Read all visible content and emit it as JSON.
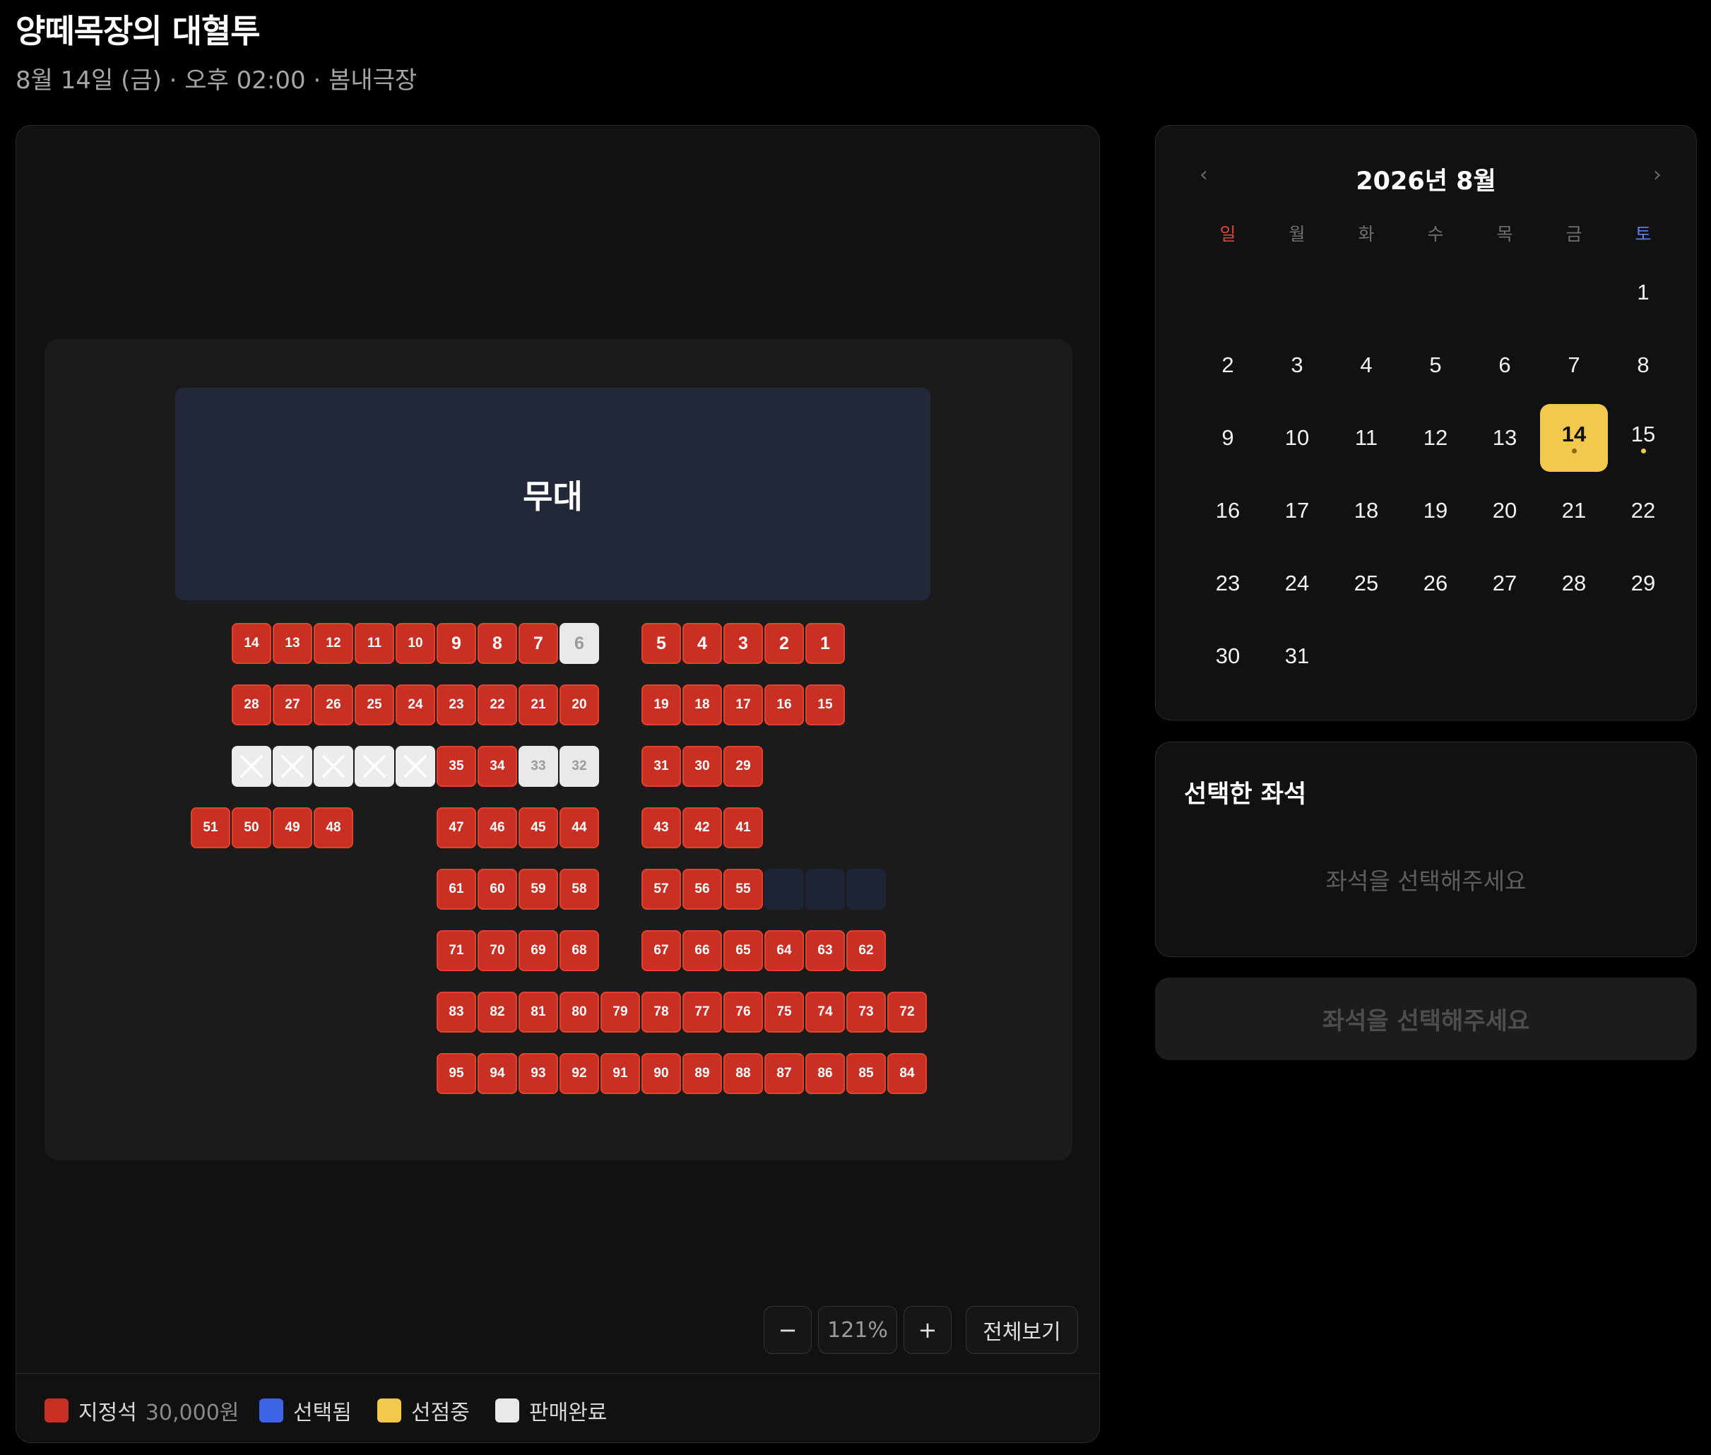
{
  "header": {
    "title": "양떼목장의 대혈투",
    "subtitle": "8월 14일 (금) · 오후 02:00 · 봄내극장"
  },
  "seat_map": {
    "stage_label": "무대",
    "seats": [
      {
        "label": "14",
        "status": "available"
      },
      {
        "label": "13",
        "status": "available"
      },
      {
        "label": "12",
        "status": "available"
      },
      {
        "label": "11",
        "status": "available"
      },
      {
        "label": "10",
        "status": "available"
      },
      {
        "label": "9",
        "status": "available"
      },
      {
        "label": "8",
        "status": "available"
      },
      {
        "label": "7",
        "status": "available"
      },
      {
        "label": "6",
        "status": "sold"
      },
      {
        "label": "5",
        "status": "available"
      },
      {
        "label": "4",
        "status": "available"
      },
      {
        "label": "3",
        "status": "available"
      },
      {
        "label": "2",
        "status": "available"
      },
      {
        "label": "1",
        "status": "available"
      },
      {
        "label": "28",
        "status": "available"
      },
      {
        "label": "27",
        "status": "available"
      },
      {
        "label": "26",
        "status": "available"
      },
      {
        "label": "25",
        "status": "available"
      },
      {
        "label": "24",
        "status": "available"
      },
      {
        "label": "23",
        "status": "available"
      },
      {
        "label": "22",
        "status": "available"
      },
      {
        "label": "21",
        "status": "available"
      },
      {
        "label": "20",
        "status": "available"
      },
      {
        "label": "19",
        "status": "available"
      },
      {
        "label": "18",
        "status": "available"
      },
      {
        "label": "17",
        "status": "available"
      },
      {
        "label": "16",
        "status": "available"
      },
      {
        "label": "15",
        "status": "available"
      },
      {
        "label": "",
        "status": "blocked"
      },
      {
        "label": "",
        "status": "blocked"
      },
      {
        "label": "",
        "status": "blocked"
      },
      {
        "label": "",
        "status": "blocked"
      },
      {
        "label": "",
        "status": "blocked"
      },
      {
        "label": "35",
        "status": "available"
      },
      {
        "label": "34",
        "status": "available"
      },
      {
        "label": "33",
        "status": "sold"
      },
      {
        "label": "32",
        "status": "sold"
      },
      {
        "label": "31",
        "status": "available"
      },
      {
        "label": "30",
        "status": "available"
      },
      {
        "label": "29",
        "status": "available"
      },
      {
        "label": "51",
        "status": "available"
      },
      {
        "label": "50",
        "status": "available"
      },
      {
        "label": "49",
        "status": "available"
      },
      {
        "label": "48",
        "status": "available"
      },
      {
        "label": "47",
        "status": "available"
      },
      {
        "label": "46",
        "status": "available"
      },
      {
        "label": "45",
        "status": "available"
      },
      {
        "label": "44",
        "status": "available"
      },
      {
        "label": "43",
        "status": "available"
      },
      {
        "label": "42",
        "status": "available"
      },
      {
        "label": "41",
        "status": "available"
      },
      {
        "label": "61",
        "status": "available"
      },
      {
        "label": "60",
        "status": "available"
      },
      {
        "label": "59",
        "status": "available"
      },
      {
        "label": "58",
        "status": "available"
      },
      {
        "label": "57",
        "status": "available"
      },
      {
        "label": "56",
        "status": "available"
      },
      {
        "label": "55",
        "status": "available"
      },
      {
        "label": "",
        "status": "empty"
      },
      {
        "label": "",
        "status": "empty"
      },
      {
        "label": "",
        "status": "empty"
      },
      {
        "label": "71",
        "status": "available"
      },
      {
        "label": "70",
        "status": "available"
      },
      {
        "label": "69",
        "status": "available"
      },
      {
        "label": "68",
        "status": "available"
      },
      {
        "label": "67",
        "status": "available"
      },
      {
        "label": "66",
        "status": "available"
      },
      {
        "label": "65",
        "status": "available"
      },
      {
        "label": "64",
        "status": "available"
      },
      {
        "label": "63",
        "status": "available"
      },
      {
        "label": "62",
        "status": "available"
      },
      {
        "label": "83",
        "status": "available"
      },
      {
        "label": "82",
        "status": "available"
      },
      {
        "label": "81",
        "status": "available"
      },
      {
        "label": "80",
        "status": "available"
      },
      {
        "label": "79",
        "status": "available"
      },
      {
        "label": "78",
        "status": "available"
      },
      {
        "label": "77",
        "status": "available"
      },
      {
        "label": "76",
        "status": "available"
      },
      {
        "label": "75",
        "status": "available"
      },
      {
        "label": "74",
        "status": "available"
      },
      {
        "label": "73",
        "status": "available"
      },
      {
        "label": "72",
        "status": "available"
      },
      {
        "label": "95",
        "status": "available"
      },
      {
        "label": "94",
        "status": "available"
      },
      {
        "label": "93",
        "status": "available"
      },
      {
        "label": "92",
        "status": "available"
      },
      {
        "label": "91",
        "status": "available"
      },
      {
        "label": "90",
        "status": "available"
      },
      {
        "label": "89",
        "status": "available"
      },
      {
        "label": "88",
        "status": "available"
      },
      {
        "label": "87",
        "status": "available"
      },
      {
        "label": "86",
        "status": "available"
      },
      {
        "label": "85",
        "status": "available"
      },
      {
        "label": "84",
        "status": "available"
      }
    ]
  },
  "zoom": {
    "minus_label": "−",
    "level": "121%",
    "plus_label": "+",
    "fit_label": "전체보기"
  },
  "legend": {
    "available_label": "지정석",
    "available_price": "30,000원",
    "selected_label": "선택됨",
    "holding_label": "선점중",
    "sold_label": "판매완료"
  },
  "calendar": {
    "title": "2026년 8월",
    "prev_icon": "‹",
    "next_icon": "›",
    "weekdays": [
      "일",
      "월",
      "화",
      "수",
      "목",
      "금",
      "토"
    ],
    "days": [
      "1",
      "2",
      "3",
      "4",
      "5",
      "6",
      "7",
      "8",
      "9",
      "10",
      "11",
      "12",
      "13",
      "14",
      "15",
      "16",
      "17",
      "18",
      "19",
      "20",
      "21",
      "22",
      "23",
      "24",
      "25",
      "26",
      "27",
      "28",
      "29",
      "30",
      "31"
    ],
    "selected_day": "14",
    "show_days": [
      "14",
      "15"
    ]
  },
  "selected_seats": {
    "title": "선택한 좌석",
    "empty_text": "좌석을 선택해주세요"
  },
  "confirm_button": {
    "label": "좌석을 선택해주세요"
  },
  "colors": {
    "available": "#c92f22",
    "selected": "#3d63e6",
    "holding": "#f2c94c",
    "sold": "#e9e9e9",
    "accent": "#f2c94c"
  }
}
